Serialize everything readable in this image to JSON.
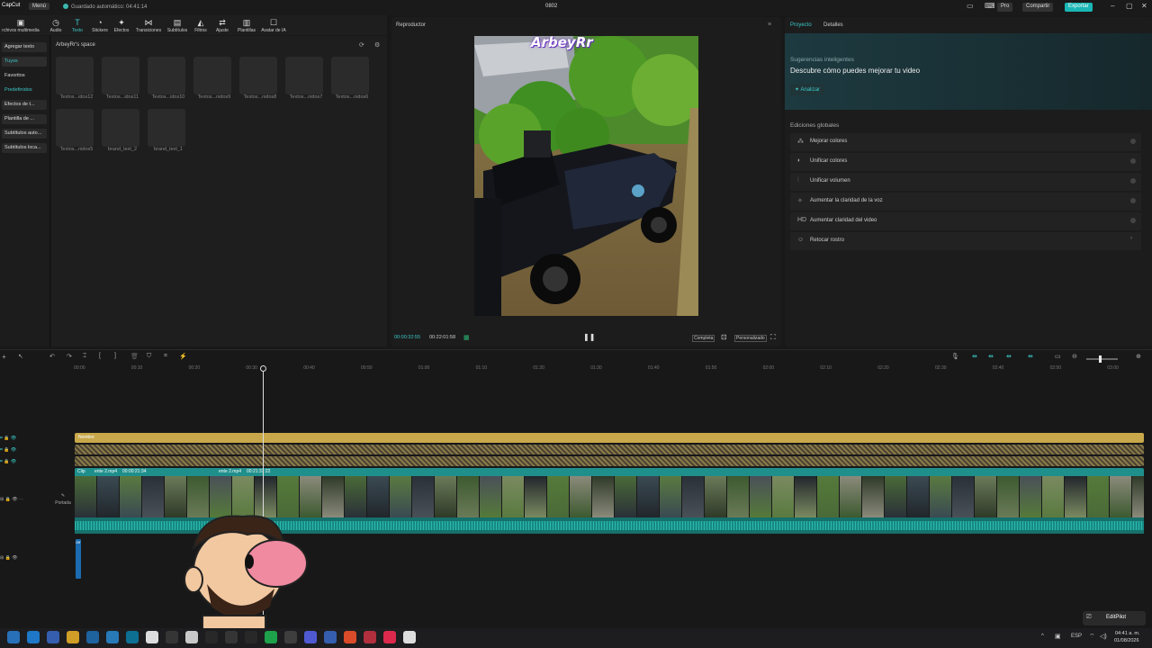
{
  "titlebar": {
    "app_logo": "CapCut",
    "menu": "Menú",
    "autosave": "Guardado automático: 04:41:14",
    "project_title": "0802",
    "pro": "Pro",
    "share": "Compartir",
    "export": "Exportar"
  },
  "toolbar": {
    "tools": [
      {
        "label": "rchivos multimedia",
        "icon": "media-icon"
      },
      {
        "label": "Audio",
        "icon": "audio-icon"
      },
      {
        "label": "Texto",
        "icon": "text-icon"
      },
      {
        "label": "Stickers",
        "icon": "sticker-icon"
      },
      {
        "label": "Efectos",
        "icon": "effects-icon"
      },
      {
        "label": "Transiciones",
        "icon": "transition-icon"
      },
      {
        "label": "Subtítulos",
        "icon": "subtitles-icon"
      },
      {
        "label": "Filtros",
        "icon": "filter-icon"
      },
      {
        "label": "Ajuste",
        "icon": "adjust-icon"
      },
      {
        "label": "Plantillas",
        "icon": "template-icon"
      },
      {
        "label": "Avatar de IA",
        "icon": "avatar-icon"
      }
    ],
    "active": "Texto"
  },
  "left_nav": {
    "items": [
      "Agregar texto",
      "Tuyos",
      "Favoritos",
      "Predefinidos",
      "Efectos de t...",
      "Plantilla de ...",
      "Subtítulos auto...",
      "Subtítulos loca..."
    ]
  },
  "library": {
    "space_title": "ArbeyRr's space",
    "row1": [
      "Textos...idos12",
      "Textos...idos11",
      "Textos...idos10",
      "Textos...nidos9",
      "Textos...nidos8",
      "Textos...nidos7",
      "Textos...nidos6"
    ],
    "row2": [
      "Textos...nidos5",
      "brand_text_2",
      "brand_text_1"
    ]
  },
  "player": {
    "title": "Reproductor",
    "current_time": "00:00:32:55",
    "total_time": "00:22:01:58",
    "btn_full": "Completa",
    "btn_custom": "Personalizado",
    "watermark": "ArbeyRr"
  },
  "props": {
    "tab_project": "Proyecto",
    "tab_details": "Detalles",
    "smart_title": "Sugerencias inteligentes",
    "smart_desc": "Descubre cómo puedes mejorar tu video",
    "analyze": "Analizar",
    "global_title": "Ediciones globales",
    "rows": [
      {
        "label": "Mejorar colores",
        "icon": "wand-icon"
      },
      {
        "label": "Unificar colores",
        "icon": "palette-icon"
      },
      {
        "label": "Unificar volumen",
        "icon": "equalizer-icon"
      },
      {
        "label": "Aumentar la claridad de la voz",
        "icon": "sparkle-icon"
      },
      {
        "label": "Aumentar claridad del video",
        "icon": "hd-icon"
      },
      {
        "label": "Retocar rostro",
        "icon": "face-icon"
      }
    ]
  },
  "timeline": {
    "ruler": [
      "00:00",
      "00:10",
      "00:20",
      "00:30",
      "00:40",
      "00:50",
      "01:00",
      "01:10",
      "01:20",
      "01:30",
      "01:40",
      "01:50",
      "02:00",
      "02:10",
      "02:20",
      "02:30",
      "02:40",
      "02:50",
      "03:00"
    ],
    "text_track_label": "Nombre",
    "clip_label": "Clip",
    "clip_name1": "ente 2.mp4",
    "clip_dur1": "00:00:21:34",
    "clip_name2": "ente 2.mp4",
    "clip_dur2": "00:21:37:22",
    "cover_label": "Portada",
    "audio_label": "Off"
  },
  "taskbar": {
    "lang": "ESP",
    "time": "04:41 a. m.",
    "date": "01/08/2026",
    "editpilot": "EditPilot"
  },
  "colors": {
    "accent": "#19b6b4",
    "text_track": "#c8a84a",
    "video_track": "#1f8f8c",
    "audio_wave": "#1a9a93"
  }
}
